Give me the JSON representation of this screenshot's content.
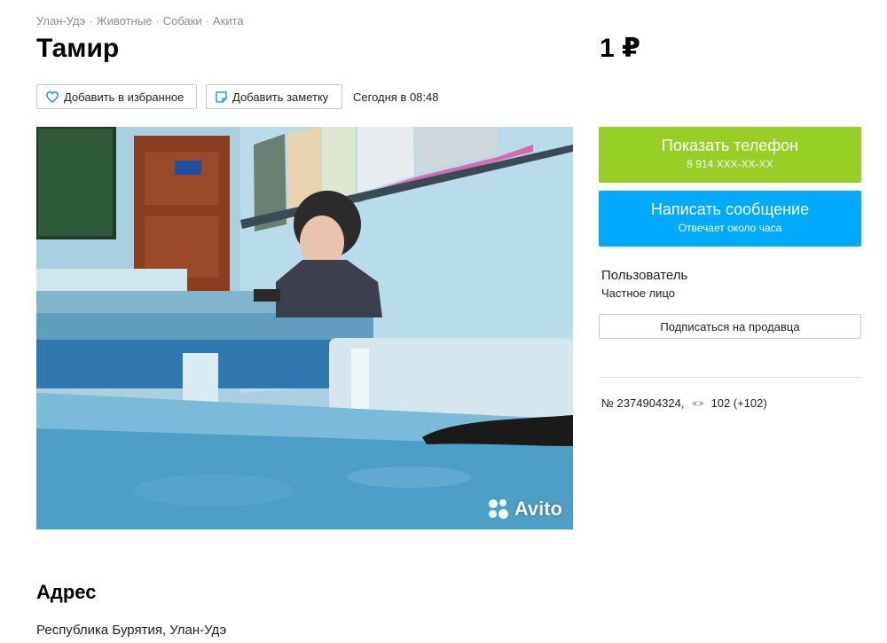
{
  "breadcrumbs": [
    "Улан-Удэ",
    "Животные",
    "Собаки",
    "Акита"
  ],
  "listing": {
    "title": "Тамир",
    "price": "1 ₽",
    "posted": "Сегодня в 08:48"
  },
  "actions": {
    "favorite_label": "Добавить в избранное",
    "note_label": "Добавить заметку"
  },
  "photo": {
    "watermark": "Avito"
  },
  "contact": {
    "phone_label": "Показать телефон",
    "phone_masked": "8 914 XXX-XX-XX",
    "message_label": "Написать сообщение",
    "message_sub": "Отвечает около часа"
  },
  "seller": {
    "name": "Пользователь",
    "type": "Частное лицо",
    "subscribe_label": "Подписаться на продавца"
  },
  "stats": {
    "ad_number": "№ 2374904324,",
    "views": "102 (+102)"
  },
  "address": {
    "heading": "Адрес",
    "text": "Республика Бурятия, Улан-Удэ"
  },
  "colors": {
    "phone_button": "#97cf26",
    "message_button": "#00aaff"
  },
  "icons": {
    "favorite": "heart-icon",
    "note": "note-icon",
    "views": "eye-icon"
  }
}
